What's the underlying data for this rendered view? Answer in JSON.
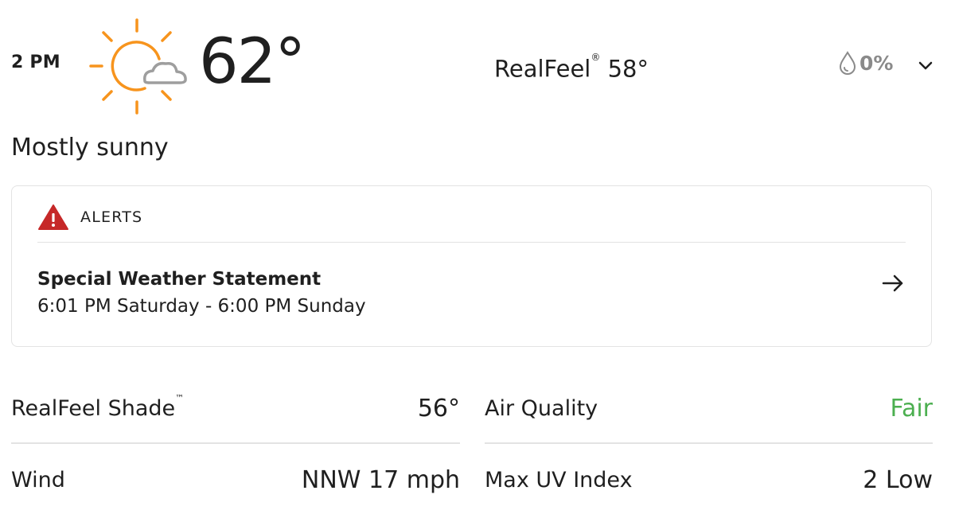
{
  "hour": {
    "time": "2 PM",
    "icon": "mostly-sunny-icon",
    "temperature": "62°"
  },
  "realfeel": {
    "label": "RealFeel",
    "mark": "®",
    "value": "58°"
  },
  "precipitation": {
    "value": "0%",
    "icon": "raindrop-icon"
  },
  "phrase": "Mostly sunny",
  "alert": {
    "header": "ALERTS",
    "title": "Special Weather Statement",
    "range": "6:01 PM Saturday - 6:00 PM Sunday",
    "accent": "#c62828"
  },
  "details": {
    "left": [
      {
        "label": "RealFeel Shade",
        "mark": "™",
        "value": "56°"
      },
      {
        "label": "Wind",
        "value": "NNW 17 mph"
      }
    ],
    "right": [
      {
        "label": "Air Quality",
        "value": "Fair",
        "color": "#4caf50"
      },
      {
        "label": "Max UV Index",
        "value": "2 Low"
      }
    ]
  },
  "colors": {
    "sun": "#f7941d",
    "cloud": "#9e9e9e",
    "muted": "#8a8a8a"
  }
}
